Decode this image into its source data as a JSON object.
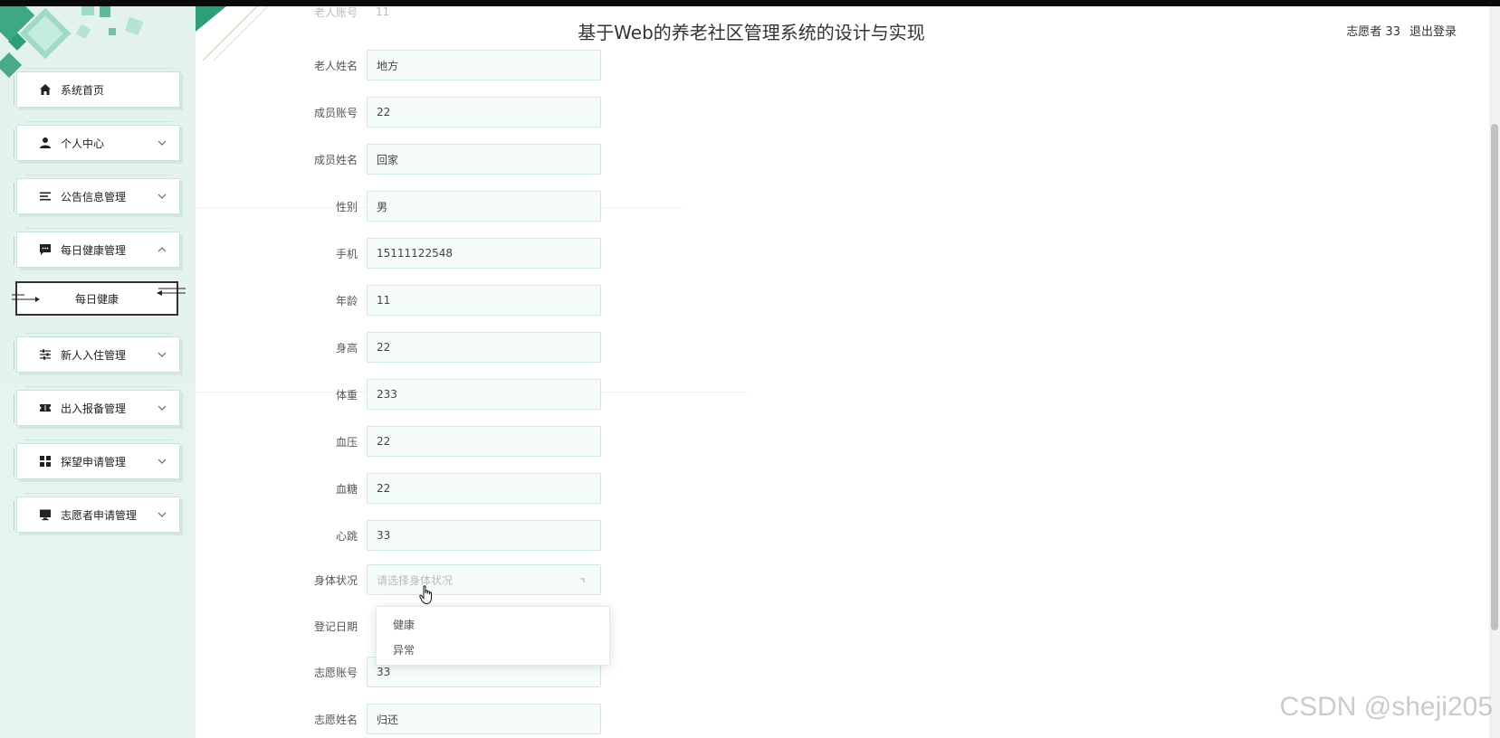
{
  "app": {
    "title": "基于Web的养老社区管理系统的设计与实现",
    "user_label": "志愿者 33",
    "logout_label": "退出登录"
  },
  "sidebar": {
    "items": [
      {
        "label": "系统首页",
        "icon": "home-icon",
        "has_arrow": false
      },
      {
        "label": "个人中心",
        "icon": "person-icon",
        "has_arrow": true
      },
      {
        "label": "公告信息管理",
        "icon": "list-icon",
        "has_arrow": true
      },
      {
        "label": "每日健康管理",
        "icon": "chat-icon",
        "has_arrow": true,
        "expanded": true
      },
      {
        "label": "新人入住管理",
        "icon": "sliders-icon",
        "has_arrow": true
      },
      {
        "label": "出入报备管理",
        "icon": "ticket-icon",
        "has_arrow": true
      },
      {
        "label": "探望申请管理",
        "icon": "grid-icon",
        "has_arrow": true
      },
      {
        "label": "志愿者申请管理",
        "icon": "monitor-icon",
        "has_arrow": true
      }
    ],
    "sub_item": {
      "label": "每日健康"
    }
  },
  "form": {
    "partial_top": {
      "label": "老人账号",
      "value": "11"
    },
    "fields": [
      {
        "label": "老人姓名",
        "value": "地方"
      },
      {
        "label": "成员账号",
        "value": "22"
      },
      {
        "label": "成员姓名",
        "value": "回家"
      },
      {
        "label": "性别",
        "value": "男"
      },
      {
        "label": "手机",
        "value": "15111122548"
      },
      {
        "label": "年龄",
        "value": "11"
      },
      {
        "label": "身高",
        "value": "22"
      },
      {
        "label": "体重",
        "value": "233"
      },
      {
        "label": "血压",
        "value": "22"
      },
      {
        "label": "血糖",
        "value": "22"
      },
      {
        "label": "心跳",
        "value": "33"
      }
    ],
    "health_status": {
      "label": "身体状况",
      "placeholder": "请选择身体状况",
      "options": [
        "健康",
        "异常"
      ]
    },
    "register_date": {
      "label": "登记日期"
    },
    "volunteer_account": {
      "label": "志愿账号",
      "value": "33"
    },
    "volunteer_name": {
      "label": "志愿姓名",
      "value": "归还"
    }
  },
  "watermark": "CSDN @sheji205",
  "colors": {
    "accent": "#2e9e78",
    "sidebar_bg": "#e3f3ec",
    "input_bg": "#f6fdf9",
    "input_border": "#cfeadd"
  }
}
